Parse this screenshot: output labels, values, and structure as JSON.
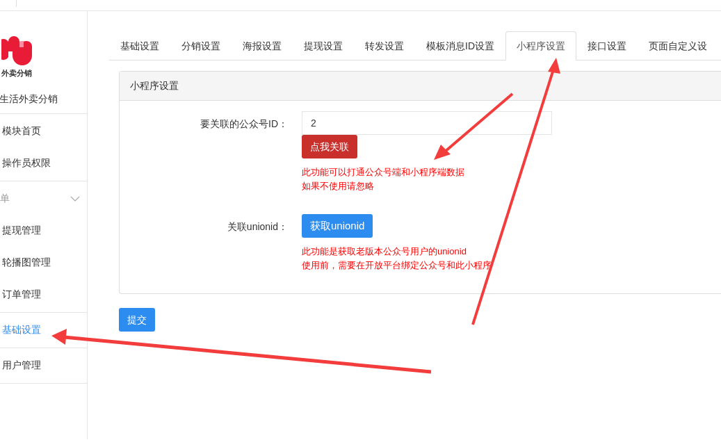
{
  "sidebar": {
    "logo_text": "外卖分销",
    "app_name": "生活外卖分销",
    "groups": [
      {
        "items": [
          {
            "label": "模块首页",
            "selected": false
          },
          {
            "label": "操作员权限",
            "selected": false
          }
        ]
      },
      {
        "title": "单",
        "expanded": true,
        "items": [
          {
            "label": "提现管理",
            "selected": false
          },
          {
            "label": "轮播图管理",
            "selected": false
          },
          {
            "label": "订单管理",
            "selected": false
          }
        ]
      },
      {
        "items": [
          {
            "label": "基础设置",
            "selected": true
          }
        ]
      },
      {
        "items": [
          {
            "label": "用户管理",
            "selected": false
          }
        ]
      }
    ]
  },
  "tabs": [
    {
      "label": "基础设置",
      "selected": false
    },
    {
      "label": "分销设置",
      "selected": false
    },
    {
      "label": "海报设置",
      "selected": false
    },
    {
      "label": "提现设置",
      "selected": false
    },
    {
      "label": "转发设置",
      "selected": false
    },
    {
      "label": "模板消息ID设置",
      "selected": false
    },
    {
      "label": "小程序设置",
      "selected": true
    },
    {
      "label": "接口设置",
      "selected": false
    },
    {
      "label": "页面自定义设",
      "selected": false
    }
  ],
  "panel": {
    "title": "小程序设置",
    "rows": [
      {
        "label": "要关联的公众号ID：",
        "kind": "input",
        "value": "2",
        "button": "点我关联",
        "color": "#c9302c",
        "notes": [
          "此功能可以打通公众号端和小程序端数据",
          "如果不使用请忽略"
        ]
      },
      {
        "label": "关联unionid：",
        "kind": "button",
        "button": "获取unionid",
        "color": "#2d8cf0",
        "notes": [
          "此功能是获取老版本公众号用户的unionid",
          "使用前，需要在开放平台绑定公众号和此小程序"
        ]
      }
    ]
  },
  "submit": "提交"
}
